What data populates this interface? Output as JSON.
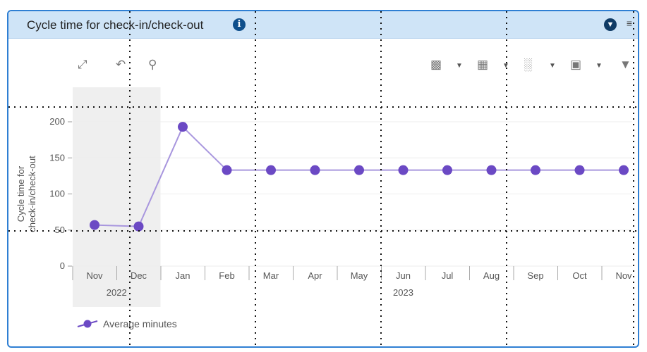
{
  "panel": {
    "title": "Cycle time for check-in/check-out",
    "info_icon": "info-icon",
    "download_icon": "download-icon",
    "menu_icon": "menu-icon"
  },
  "toolbar": {
    "left": [
      "expand-icon",
      "undo-icon",
      "zoom-out-icon"
    ],
    "right": [
      "add-series-icon",
      "chart-grid-icon",
      "bar-chart-icon",
      "select-icon",
      "filter-icon"
    ]
  },
  "colors": {
    "series": "#6b49c4",
    "line": "#a896de",
    "header": "#cfe4f7",
    "border": "#2f7fd3"
  },
  "chart_data": {
    "type": "line",
    "ylabel": "Cycle time for check-in/check-out",
    "ylim": [
      0,
      200
    ],
    "yticks": [
      0,
      50,
      100,
      150,
      200
    ],
    "categories": [
      "Nov",
      "Dec",
      "Jan",
      "Feb",
      "Mar",
      "Apr",
      "May",
      "Jun",
      "Jul",
      "Aug",
      "Sep",
      "Oct",
      "Nov"
    ],
    "year_groups": [
      {
        "label": "2022",
        "from": 0,
        "to": 1
      },
      {
        "label": "2023",
        "from": 2,
        "to": 12
      }
    ],
    "series": [
      {
        "name": "Average minutes",
        "values": [
          57,
          55,
          193,
          133,
          133,
          133,
          133,
          133,
          133,
          133,
          133,
          133,
          133
        ]
      }
    ],
    "highlight_range": [
      0,
      1
    ],
    "grid": true,
    "legend": "bottom-left"
  }
}
